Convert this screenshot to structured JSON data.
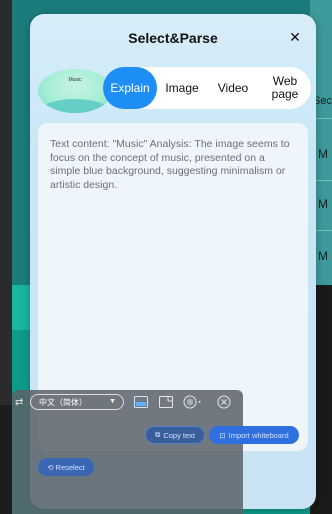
{
  "dialog": {
    "title": "Select&Parse",
    "close_label": "✕",
    "thumbnail_label": "Music",
    "tabs": [
      {
        "label": "Explain",
        "active": true
      },
      {
        "label": "Image",
        "active": false
      },
      {
        "label": "Video",
        "active": false
      },
      {
        "label": "Web page",
        "active": false
      }
    ],
    "content": "Text content: \"Music\"  Analysis: The image seems to focus on the concept of music, presented on a simple blue background, suggesting minimalism or artistic design."
  },
  "background": {
    "right_items": [
      "Sec",
      "M",
      "M",
      "M"
    ]
  },
  "toolbar": {
    "language": "中文（简体）",
    "copy_label": "Copy text",
    "import_label": "Import whiteboard",
    "reselect_label": "Reselect"
  },
  "colors": {
    "accent": "#1e8ef7",
    "dialog_bg": "#d8eef9",
    "teal": "#19b6a0"
  },
  "icons": [
    "swap-icon",
    "translate-icon",
    "window-icon",
    "speech-icon",
    "close-circle-icon",
    "copy-icon",
    "import-icon",
    "reselect-icon",
    "close-icon"
  ]
}
